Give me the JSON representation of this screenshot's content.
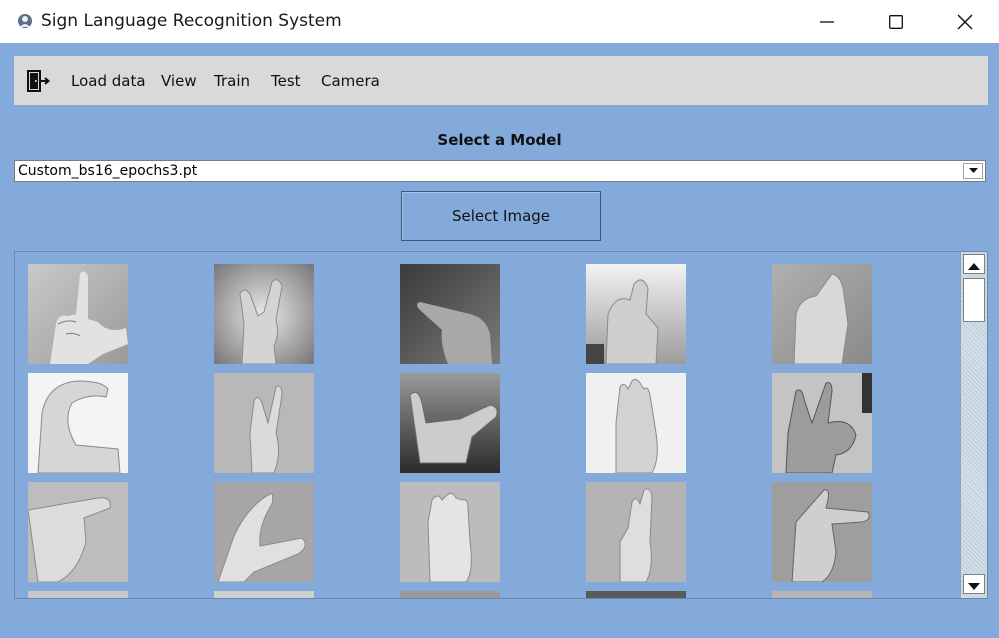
{
  "window": {
    "title": "Sign Language Recognition System",
    "minimize_icon": "minimize-icon",
    "maximize_icon": "maximize-icon",
    "close_icon": "close-icon"
  },
  "menu": {
    "exit_icon": "exit-door-icon",
    "items": [
      "Load data",
      "View",
      "Train",
      "Test",
      "Camera"
    ]
  },
  "model": {
    "label": "Select a Model",
    "selected": "Custom_bs16_epochs3.pt"
  },
  "actions": {
    "select_image": "Select Image"
  },
  "gallery": {
    "columns": 5,
    "visible_rows": 3,
    "images": [
      "hand-sign-l",
      "hand-sign-v",
      "hand-sign-point",
      "hand-sign-x",
      "hand-sign-fist",
      "hand-sign-c",
      "hand-sign-v2",
      "hand-sign-y",
      "hand-sign-f",
      "hand-sign-k",
      "hand-sign-h",
      "hand-sign-c2",
      "hand-sign-b",
      "hand-sign-u",
      "hand-sign-g"
    ]
  },
  "colors": {
    "background": "#84aadc",
    "menubar": "#d9d9d9",
    "titlebar": "#ffffff"
  }
}
